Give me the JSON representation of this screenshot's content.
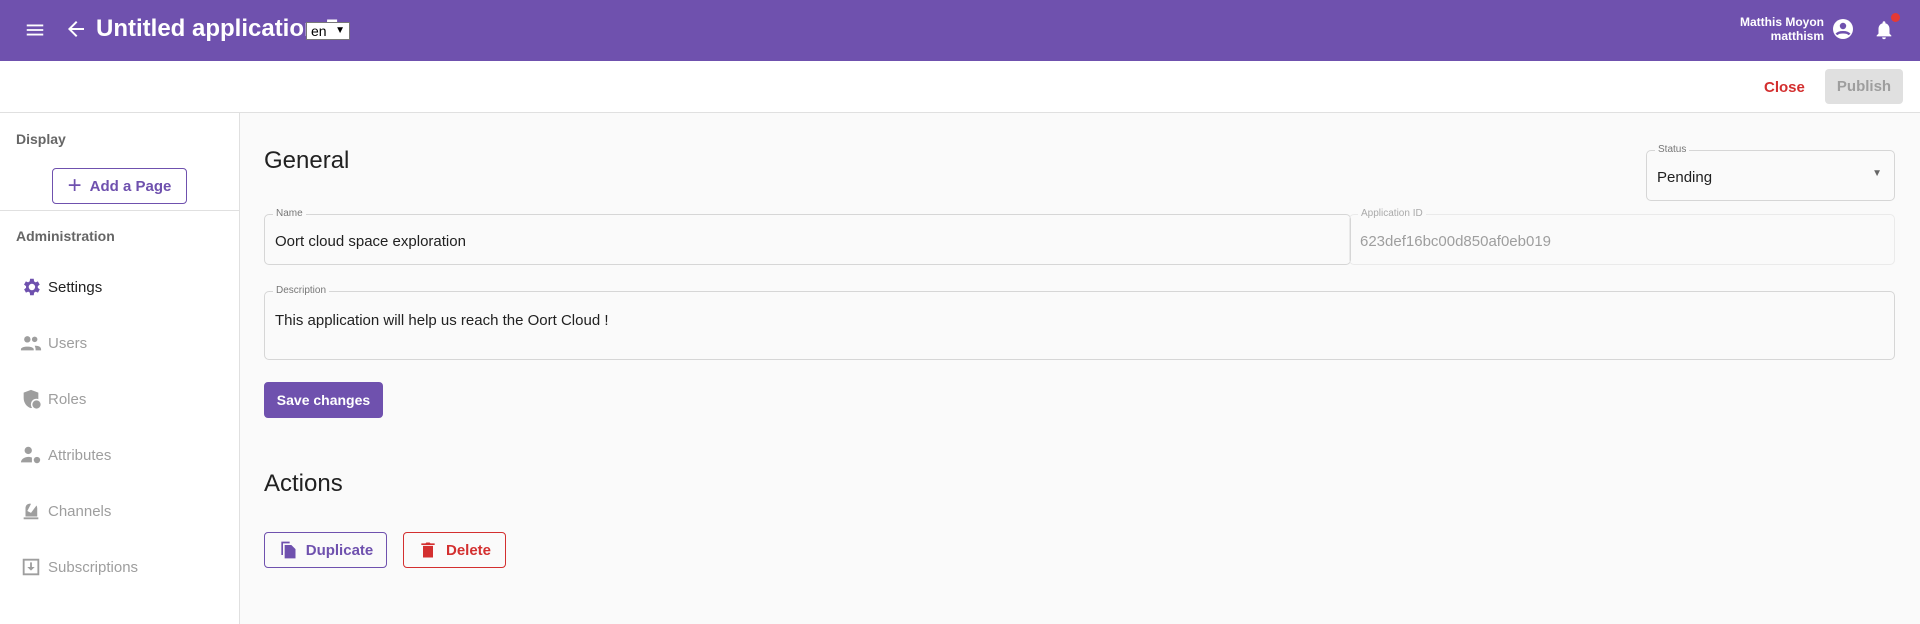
{
  "header": {
    "title": "Untitled application 5",
    "language": "en",
    "user_name": "Matthis Moyon",
    "user_login": "matthism",
    "menu_icon": "menu-icon",
    "back_icon": "arrow-left-icon",
    "account_icon": "account-circle-icon",
    "notification_icon": "bell-icon",
    "notification_dot_color": "#e53935"
  },
  "toolbar": {
    "close_label": "Close",
    "publish_label": "Publish"
  },
  "sidebar": {
    "display_heading": "Display",
    "add_page_label": "Add a Page",
    "admin_heading": "Administration",
    "items": [
      {
        "label": "Settings",
        "icon": "gear-icon",
        "active": true
      },
      {
        "label": "Users",
        "icon": "users-icon"
      },
      {
        "label": "Roles",
        "icon": "shield-icon"
      },
      {
        "label": "Attributes",
        "icon": "user-settings-icon"
      },
      {
        "label": "Channels",
        "icon": "channel-icon"
      },
      {
        "label": "Subscriptions",
        "icon": "inbox-icon"
      }
    ]
  },
  "general": {
    "title": "General",
    "status_label": "Status",
    "status_value": "Pending",
    "name_label": "Name",
    "name_value": "Oort cloud space exploration",
    "app_id_label": "Application ID",
    "app_id_value": "623def16bc00d850af0eb019",
    "description_label": "Description",
    "description_value": "This application will help us reach the Oort Cloud !",
    "save_label": "Save changes"
  },
  "actions": {
    "title": "Actions",
    "duplicate_label": "Duplicate",
    "delete_label": "Delete"
  },
  "colors": {
    "primary": "#6f51ae",
    "danger": "#d32f2f"
  }
}
